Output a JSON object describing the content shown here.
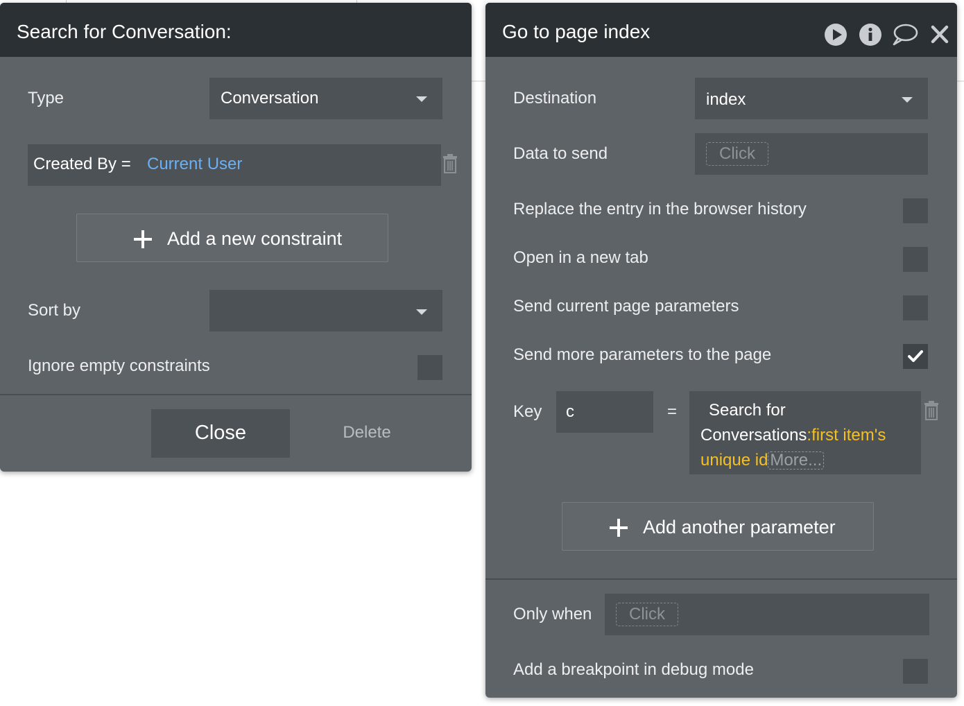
{
  "search_panel": {
    "title": "Search for Conversation:",
    "type_label": "Type",
    "type_value": "Conversation",
    "constraint": {
      "field": "Created By =",
      "value": "Current User"
    },
    "add_constraint_label": "Add a new constraint",
    "sort_by_label": "Sort by",
    "sort_by_value": "",
    "ignore_empty_label": "Ignore empty constraints",
    "ignore_empty_checked": false,
    "close_label": "Close",
    "delete_label": "Delete"
  },
  "goto_panel": {
    "title": "Go to page index",
    "destination_label": "Destination",
    "destination_value": "index",
    "data_to_send_label": "Data to send",
    "click_placeholder": "Click",
    "replace_history_label": "Replace the entry in the browser history",
    "replace_history_checked": false,
    "new_tab_label": "Open in a new tab",
    "new_tab_checked": false,
    "send_current_params_label": "Send current page parameters",
    "send_current_params_checked": false,
    "send_more_params_label": "Send more parameters to the page",
    "send_more_params_checked": true,
    "param": {
      "key_label": "Key",
      "key_value": "c",
      "equals": "=",
      "value_line1": "Search for",
      "value_line2_prefix": "Conversations",
      "value_colon": ":",
      "value_line2_highlight": "first item's",
      "value_line3_highlight": "unique id",
      "more_label": "More..."
    },
    "add_param_label": "Add another parameter",
    "only_when_label": "Only when",
    "only_when_placeholder": "Click",
    "breakpoint_label": "Add a breakpoint in debug mode",
    "breakpoint_checked": false
  },
  "colors": {
    "header_bg": "#2a3034",
    "panel_bg": "#5e6368",
    "field_bg": "#4d5257",
    "link_blue": "#6ab0f3",
    "highlight_yellow": "#f5c022"
  },
  "icons": [
    "play-icon",
    "info-icon",
    "comment-icon",
    "close-icon",
    "trash-icon",
    "plus-icon",
    "check-icon",
    "chevron-down-icon"
  ]
}
